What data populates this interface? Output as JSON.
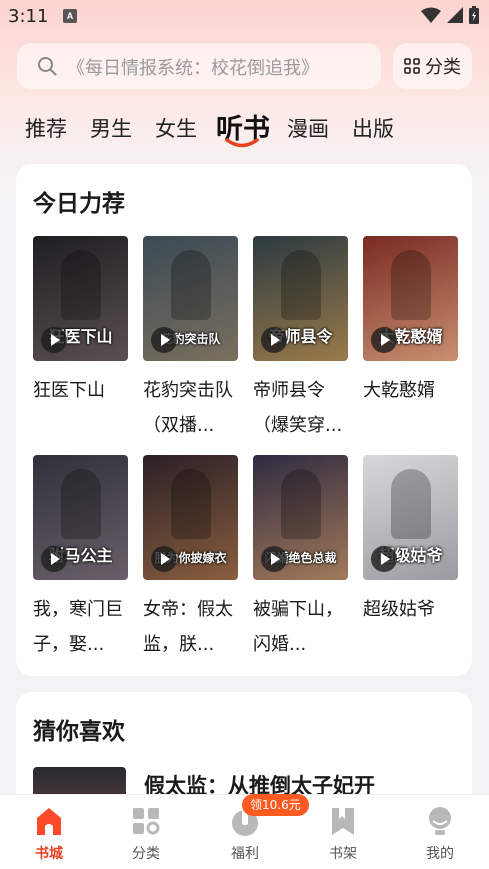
{
  "status_bar": {
    "time": "3:11",
    "app_icon_letter": "A"
  },
  "search": {
    "placeholder": "《每日情报系统：校花倒追我》",
    "category_label": "分类"
  },
  "tabs": [
    {
      "label": "推荐"
    },
    {
      "label": "男生"
    },
    {
      "label": "女生"
    },
    {
      "label": "听书",
      "active": true
    },
    {
      "label": "漫画"
    },
    {
      "label": "出版"
    }
  ],
  "recommend": {
    "title": "今日力荐",
    "books": [
      {
        "name": "狂医下山",
        "cover_text": "狂医下山",
        "colors": [
          "#1e1e22",
          "#5b5050"
        ]
      },
      {
        "name": "花豹突击队（双播...",
        "cover_text": "花豹突击队",
        "colors": [
          "#3a4a55",
          "#7a6f5e"
        ]
      },
      {
        "name": "帝师县令（爆笑穿...",
        "cover_text": "帝师县令",
        "colors": [
          "#2b3a40",
          "#9b7b4a"
        ]
      },
      {
        "name": "大乾憨婿",
        "cover_text": "大乾憨婿",
        "colors": [
          "#7a2a22",
          "#c89070"
        ]
      },
      {
        "name": "我，寒门巨子，娶...",
        "cover_text": "驸马公主",
        "colors": [
          "#2e3138",
          "#6a5f6a"
        ]
      },
      {
        "name": "女帝：假太监，朕...",
        "cover_text": "朕为你披嫁衣",
        "colors": [
          "#2a2026",
          "#8a5e3e"
        ]
      },
      {
        "name": "被骗下山，闪婚...",
        "cover_text": "闪婚绝色总裁",
        "colors": [
          "#2e2a40",
          "#a37a5a"
        ]
      },
      {
        "name": "超级姑爷",
        "cover_text": "超级姑爷",
        "colors": [
          "#d8d8dc",
          "#9a9aa0"
        ]
      }
    ]
  },
  "guess": {
    "title": "猜你喜欢",
    "items": [
      {
        "title": "假太监：从推倒太子妃开"
      }
    ]
  },
  "bottom_nav": {
    "items": [
      {
        "label": "书城",
        "icon": "home-icon",
        "active": true
      },
      {
        "label": "分类",
        "icon": "grid-icon"
      },
      {
        "label": "福利",
        "icon": "gift-icon"
      },
      {
        "label": "书架",
        "icon": "bookmark-icon"
      },
      {
        "label": "我的",
        "icon": "profile-icon"
      }
    ],
    "welfare_badge": "领10.6元"
  },
  "colors": {
    "accent": "#e8411f",
    "badge": "#ff5a1f"
  }
}
